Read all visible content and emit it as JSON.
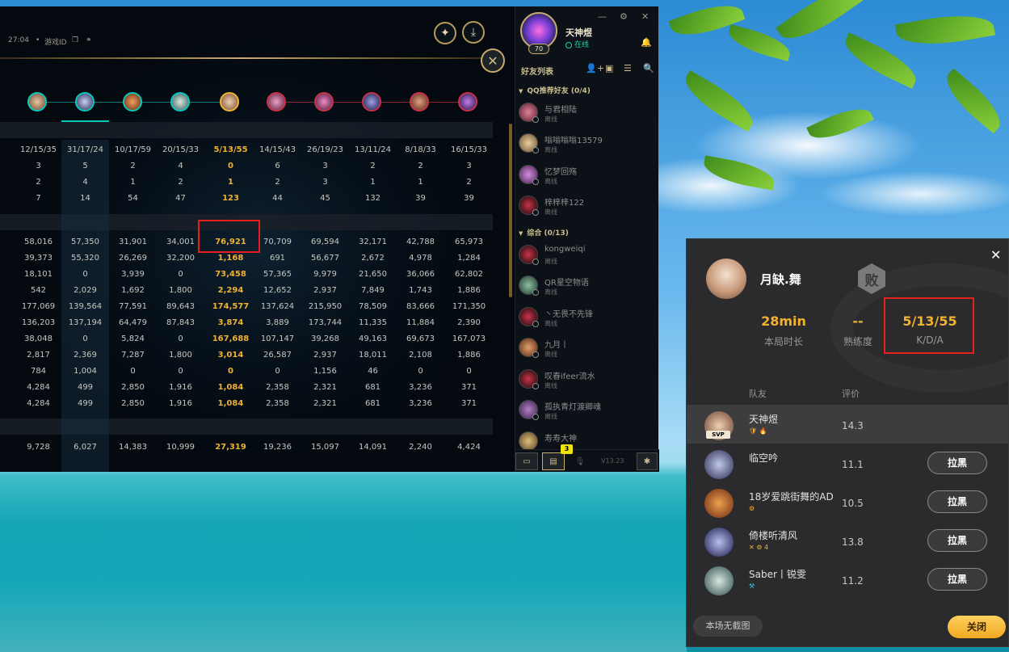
{
  "colors": {
    "accent_gold": "#f0b232",
    "highlight_red": "#e5201c",
    "online_green": "#1cd5a0",
    "team_blue": "#0ac8b9",
    "team_red": "#c8334a"
  },
  "stats": {
    "header": {
      "time": "27:04",
      "game_id_label": "游戏ID"
    },
    "rows": [
      [
        "12/15/35",
        "31/17/24",
        "10/17/59",
        "20/15/33",
        "5/13/55",
        "14/15/43",
        "26/19/23",
        "13/11/24",
        "8/18/33",
        "16/15/33"
      ],
      [
        "3",
        "5",
        "2",
        "4",
        "0",
        "6",
        "3",
        "2",
        "2",
        "3"
      ],
      [
        "2",
        "4",
        "1",
        "2",
        "1",
        "2",
        "3",
        "1",
        "1",
        "2"
      ],
      [
        "7",
        "14",
        "54",
        "47",
        "123",
        "44",
        "45",
        "132",
        "39",
        "39"
      ],
      [
        "58,016",
        "57,350",
        "31,901",
        "34,001",
        "76,921",
        "70,709",
        "69,594",
        "32,171",
        "42,788",
        "65,973"
      ],
      [
        "39,373",
        "55,320",
        "26,269",
        "32,200",
        "1,168",
        "691",
        "56,677",
        "2,672",
        "4,978",
        "1,284"
      ],
      [
        "18,101",
        "0",
        "3,939",
        "0",
        "73,458",
        "57,365",
        "9,979",
        "21,650",
        "36,066",
        "62,802"
      ],
      [
        "542",
        "2,029",
        "1,692",
        "1,800",
        "2,294",
        "12,652",
        "2,937",
        "7,849",
        "1,743",
        "1,886"
      ],
      [
        "177,069",
        "139,564",
        "77,591",
        "89,643",
        "174,577",
        "137,624",
        "215,950",
        "78,509",
        "83,666",
        "171,350"
      ],
      [
        "136,203",
        "137,194",
        "64,479",
        "87,843",
        "3,874",
        "3,889",
        "173,744",
        "11,335",
        "11,884",
        "2,390"
      ],
      [
        "38,048",
        "0",
        "5,824",
        "0",
        "167,688",
        "107,147",
        "39,268",
        "49,163",
        "69,673",
        "167,073"
      ],
      [
        "2,817",
        "2,369",
        "7,287",
        "1,800",
        "3,014",
        "26,587",
        "2,937",
        "18,011",
        "2,108",
        "1,886"
      ],
      [
        "784",
        "1,004",
        "0",
        "0",
        "0",
        "0",
        "1,156",
        "46",
        "0",
        "0"
      ],
      [
        "4,284",
        "499",
        "2,850",
        "1,916",
        "1,084",
        "2,358",
        "2,321",
        "681",
        "3,236",
        "371"
      ],
      [
        "4,284",
        "499",
        "2,850",
        "1,916",
        "1,084",
        "2,358",
        "2,321",
        "681",
        "3,236",
        "371"
      ],
      [
        "9,728",
        "6,027",
        "14,383",
        "10,999",
        "27,319",
        "19,236",
        "15,097",
        "14,091",
        "2,240",
        "4,424"
      ]
    ]
  },
  "friends": {
    "user": {
      "name": "天神煜",
      "status": "在线",
      "level": "70"
    },
    "title": "好友列表",
    "groups": [
      {
        "label": "QQ推荐好友 (0/4)"
      },
      {
        "label": "综合 (0/13)"
      }
    ],
    "list": [
      {
        "name": "与君相陆",
        "status": "离线"
      },
      {
        "name": "嗡嗡嗡嗡13579",
        "status": "离线"
      },
      {
        "name": "忆梦回殇",
        "status": "离线"
      },
      {
        "name": "梓梓梓122",
        "status": "离线"
      },
      {
        "name": "kongweiqi",
        "status": "离线"
      },
      {
        "name": "QR星空物语",
        "status": "离线"
      },
      {
        "name": "丶无畏不先锋",
        "status": "离线"
      },
      {
        "name": "九月丨",
        "status": "离线"
      },
      {
        "name": "叹春ifeer流水",
        "status": "离线"
      },
      {
        "name": "孤执青灯渡卿魂",
        "status": "离线"
      },
      {
        "name": "寿寿大神",
        "status": ""
      }
    ],
    "badge_count": "3",
    "version": "V13.23"
  },
  "popup": {
    "player_name": "月缺.舞",
    "result": "败",
    "stats": [
      {
        "value": "28min",
        "label": "本局时长"
      },
      {
        "value": "--",
        "label": "熟练度"
      },
      {
        "value": "5/13/55",
        "label": "K/D/A"
      }
    ],
    "col_teammate": "队友",
    "col_rating": "评价",
    "teammates": [
      {
        "name": "天神煜",
        "score": "14.3",
        "badge": "SVP",
        "tags": "🛡 🔥",
        "action": ""
      },
      {
        "name": "临空吟",
        "score": "11.1",
        "tags": "",
        "action": "拉黑"
      },
      {
        "name": "18岁爱跳街舞的AD",
        "score": "10.5",
        "tags": "⚙",
        "action": "拉黑"
      },
      {
        "name": "倚楼听清风",
        "score": "13.8",
        "tags": "✕ ⚙ 4",
        "action": "拉黑"
      },
      {
        "name": "Saber丨锐雯",
        "score": "11.2",
        "tags": "⚒",
        "action": "拉黑"
      }
    ],
    "no_screenshot": "本场无截图",
    "close": "关闭"
  }
}
